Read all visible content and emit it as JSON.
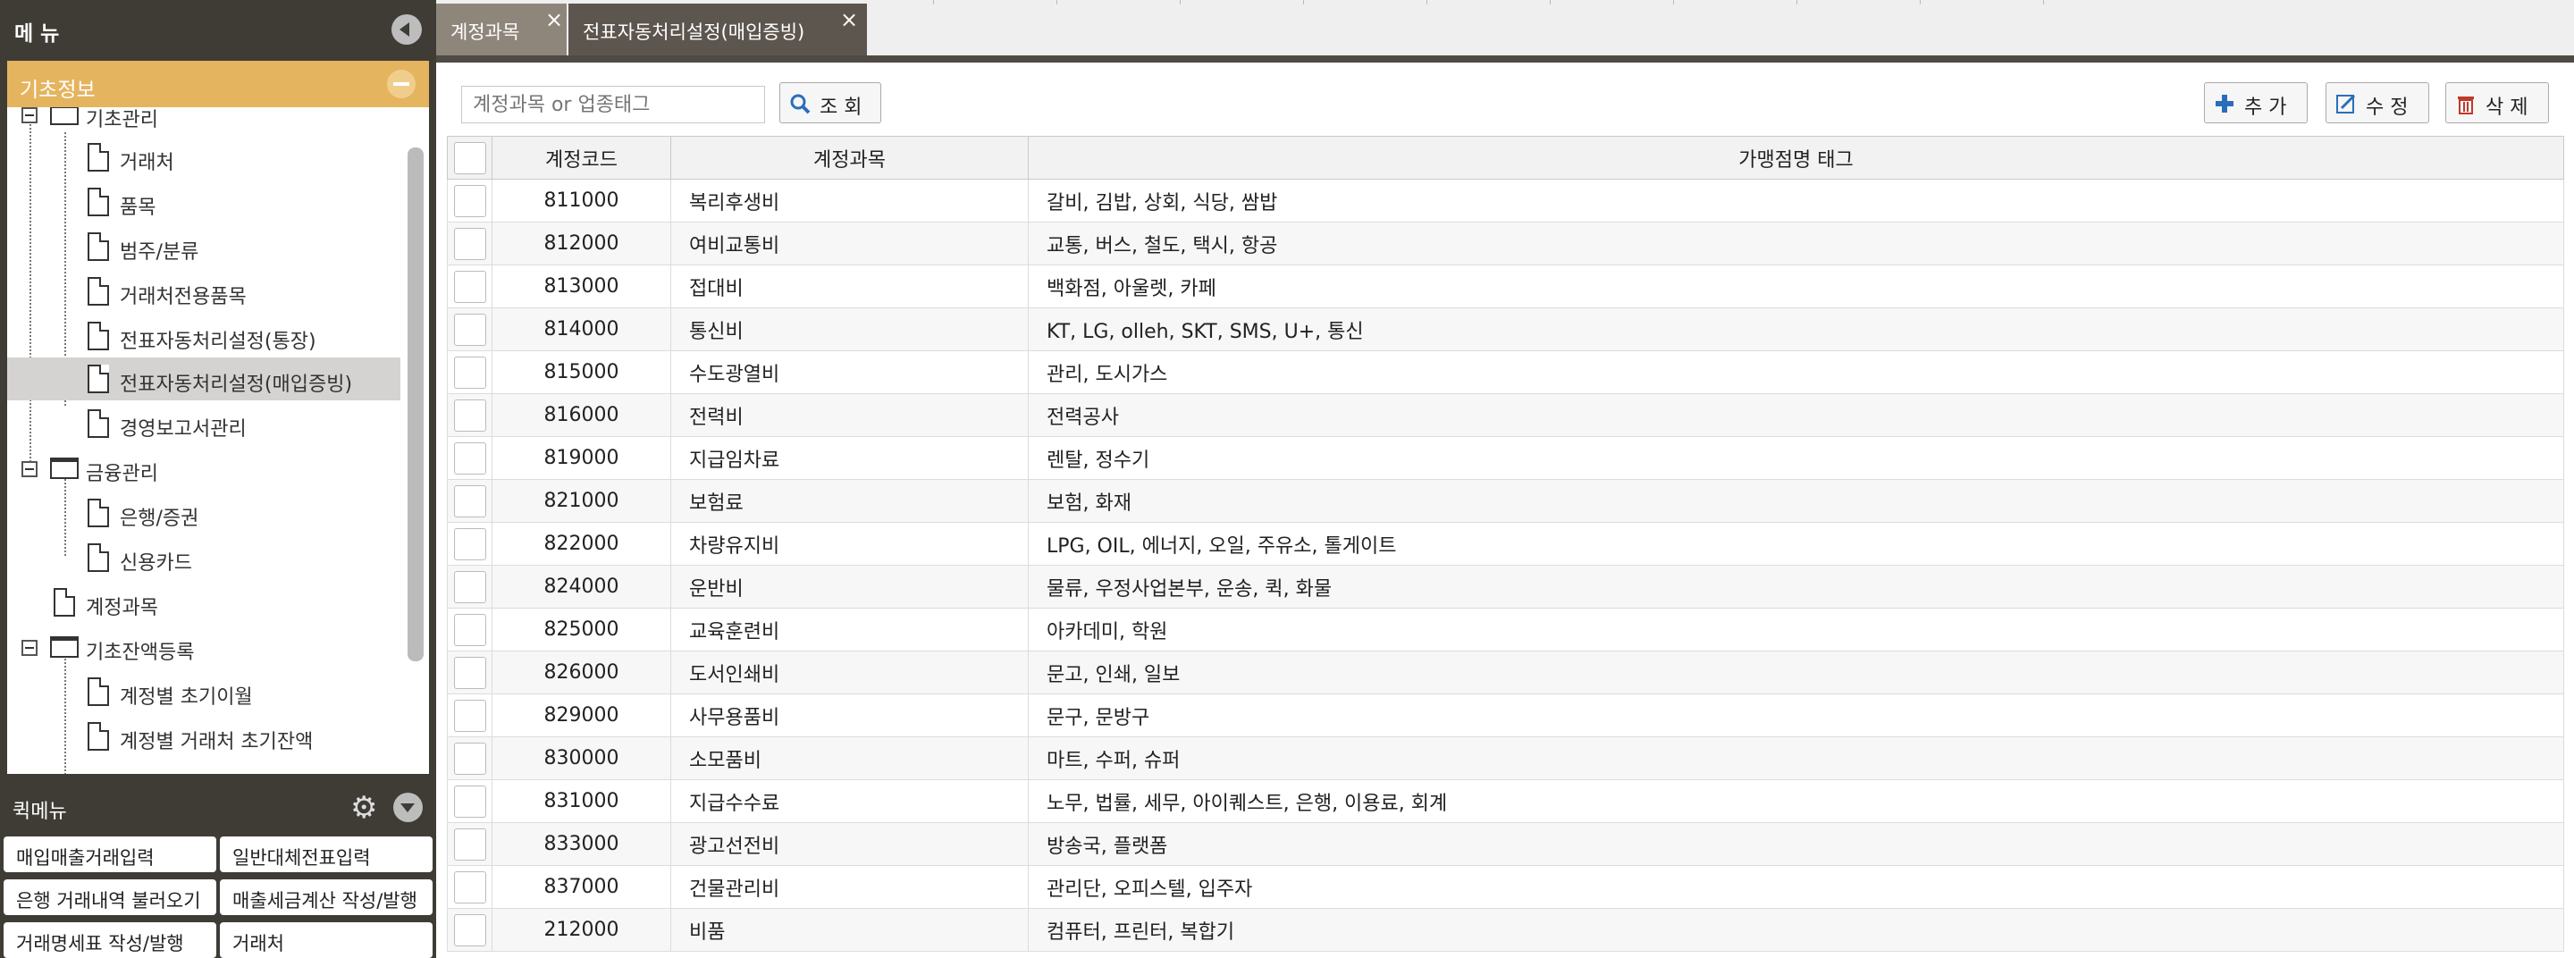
{
  "menu": {
    "title": "메 뉴"
  },
  "category": {
    "title": "기초정보"
  },
  "tree": [
    {
      "label": "기초관리",
      "type": "folder"
    },
    {
      "label": "거래처",
      "type": "file"
    },
    {
      "label": "품목",
      "type": "file"
    },
    {
      "label": "범주/분류",
      "type": "file"
    },
    {
      "label": "거래처전용품목",
      "type": "file"
    },
    {
      "label": "전표자동처리설정(통장)",
      "type": "file"
    },
    {
      "label": "전표자동처리설정(매입증빙)",
      "type": "file",
      "selected": true
    },
    {
      "label": "경영보고서관리",
      "type": "file"
    },
    {
      "label": "금융관리",
      "type": "folder"
    },
    {
      "label": "은행/증권",
      "type": "file"
    },
    {
      "label": "신용카드",
      "type": "file"
    },
    {
      "label": "계정과목",
      "type": "file"
    },
    {
      "label": "기초잔액등록",
      "type": "folder"
    },
    {
      "label": "계정별 초기이월",
      "type": "file"
    },
    {
      "label": "계정별 거래처 초기잔액",
      "type": "file"
    }
  ],
  "quick_menu": {
    "title": "퀵메뉴",
    "buttons": [
      "매입매출거래입력",
      "일반대체전표입력",
      "은행 거래내역 불러오기",
      "매출세금계산 작성/발행",
      "거래명세표 작성/발행",
      "거래처"
    ]
  },
  "tabs": [
    {
      "label": "계정과목"
    },
    {
      "label": "전표자동처리설정(매입증빙)",
      "active": true
    }
  ],
  "toolbar": {
    "search_placeholder": "계정과목 or 업종태그",
    "search_button": "조 회",
    "add_button": "추 가",
    "edit_button": "수 정",
    "delete_button": "삭 제"
  },
  "table": {
    "headers": [
      "계정코드",
      "계정과목",
      "가맹점명 태그"
    ],
    "rows": [
      {
        "code": "811000",
        "account": "복리후생비",
        "tags": "갈비, 김밥, 상회, 식당, 쌈밥"
      },
      {
        "code": "812000",
        "account": "여비교통비",
        "tags": "교통, 버스, 철도, 택시, 항공"
      },
      {
        "code": "813000",
        "account": "접대비",
        "tags": "백화점, 아울렛, 카페"
      },
      {
        "code": "814000",
        "account": "통신비",
        "tags": "KT, LG, olleh, SKT, SMS, U+, 통신"
      },
      {
        "code": "815000",
        "account": "수도광열비",
        "tags": "관리, 도시가스"
      },
      {
        "code": "816000",
        "account": "전력비",
        "tags": "전력공사"
      },
      {
        "code": "819000",
        "account": "지급임차료",
        "tags": "렌탈, 정수기"
      },
      {
        "code": "821000",
        "account": "보험료",
        "tags": "보험, 화재"
      },
      {
        "code": "822000",
        "account": "차량유지비",
        "tags": "LPG, OIL, 에너지, 오일, 주유소, 톨게이트"
      },
      {
        "code": "824000",
        "account": "운반비",
        "tags": "물류, 우정사업본부, 운송, 퀵, 화물"
      },
      {
        "code": "825000",
        "account": "교육훈련비",
        "tags": "아카데미, 학원"
      },
      {
        "code": "826000",
        "account": "도서인쇄비",
        "tags": "문고, 인쇄, 일보"
      },
      {
        "code": "829000",
        "account": "사무용품비",
        "tags": "문구, 문방구"
      },
      {
        "code": "830000",
        "account": "소모품비",
        "tags": "마트, 수퍼, 슈퍼"
      },
      {
        "code": "831000",
        "account": "지급수수료",
        "tags": "노무, 법률, 세무, 아이퀘스트, 은행, 이용료, 회계"
      },
      {
        "code": "833000",
        "account": "광고선전비",
        "tags": "방송국, 플랫폼"
      },
      {
        "code": "837000",
        "account": "건물관리비",
        "tags": "관리단, 오피스텔, 입주자"
      },
      {
        "code": "212000",
        "account": "비품",
        "tags": "컴퓨터, 프린터, 복합기"
      }
    ]
  },
  "colors": {
    "sidebar_bg": "#3f3c36",
    "category_accent": "#e5b45f",
    "active_tab": "#5d564e",
    "inactive_tab": "#8f867b"
  }
}
